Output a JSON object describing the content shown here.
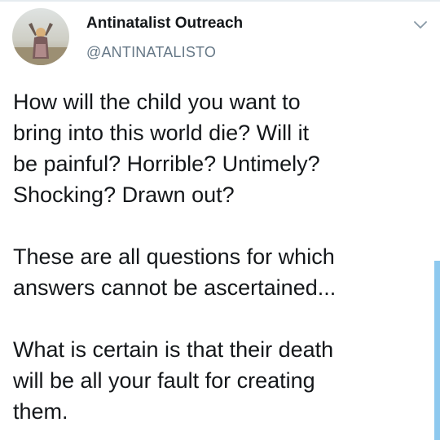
{
  "tweet": {
    "author": {
      "display_name": "Antinatalist Outreach",
      "handle": "@ANTINATALISTO",
      "avatar_icon": "avatar-photo"
    },
    "menu_icon": "chevron-down-icon",
    "text": "How will the child you want to\nbring into this world die? Will it\nbe painful? Horrible? Untimely?\nShocking? Drawn out?\n\nThese are all questions for which\nanswers cannot be ascertained...\n\nWhat is certain is that their death\nwill be all your fault for creating\nthem."
  },
  "colors": {
    "text": "#14171a",
    "secondary_text": "#657786",
    "scrollbar": "#8ec9ef"
  }
}
